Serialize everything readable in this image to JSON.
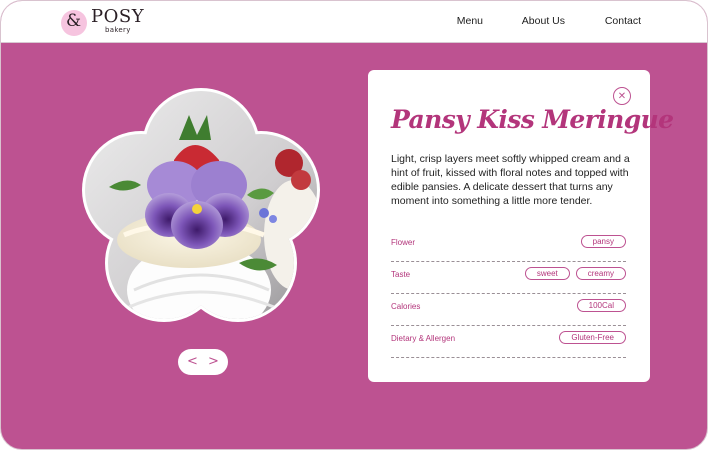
{
  "brand": {
    "mark": "&",
    "name": "POSY",
    "sub": "bakery",
    "accent": "#bd5291",
    "logo_pink": "#f6c4df"
  },
  "nav": {
    "items": [
      "Menu",
      "About Us",
      "Contact"
    ]
  },
  "hero_image": {
    "subject": "meringue dessert topped with a purple pansy and strawberries",
    "shape": "five-petal flower"
  },
  "pager": {
    "prev": "<",
    "next": ">"
  },
  "card": {
    "close": "✕",
    "title": "Pansy Kiss Meringue",
    "description": "Light, crisp layers meet softly whipped cream and a hint of fruit, kissed with floral notes and topped with edible pansies. A delicate dessert that turns any moment into something a little more tender.",
    "attributes": [
      {
        "label": "Flower",
        "tags": [
          "pansy"
        ]
      },
      {
        "label": "Taste",
        "tags": [
          "sweet",
          "creamy"
        ]
      },
      {
        "label": "Calories",
        "tags": [
          "100Cal"
        ]
      },
      {
        "label": "Dietary & Allergen",
        "tags": [
          "Gluten-Free"
        ]
      }
    ]
  }
}
